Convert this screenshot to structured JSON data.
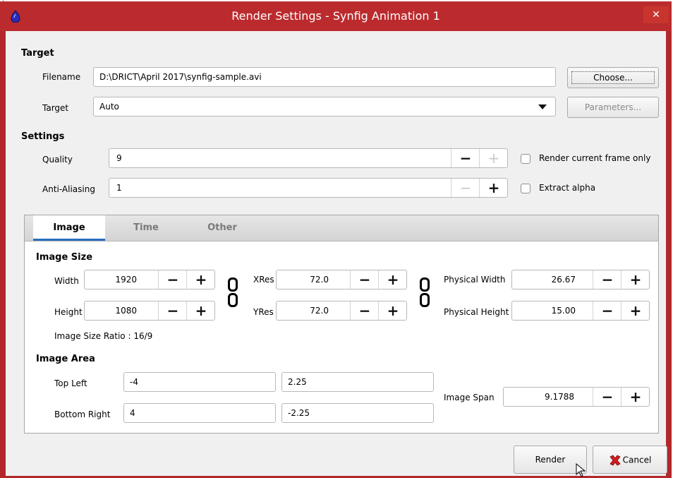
{
  "window": {
    "title": "Render Settings - Synfig Animation 1",
    "close_glyph": "✕"
  },
  "target": {
    "section": "Target",
    "filename_label": "Filename",
    "filename_value": "D:\\DRICT\\April 2017\\synfig-sample.avi",
    "choose_label": "Choose...",
    "target_label": "Target",
    "target_value": "Auto",
    "parameters_label": "Parameters..."
  },
  "settings": {
    "section": "Settings",
    "quality_label": "Quality",
    "quality_value": "9",
    "antialiasing_label": "Anti-Aliasing",
    "antialiasing_value": "1",
    "render_current_frame_label": "Render current frame only",
    "extract_alpha_label": "Extract alpha",
    "minus": "−",
    "plus": "+"
  },
  "tabs": {
    "image": "Image",
    "time": "Time",
    "other": "Other"
  },
  "image_size": {
    "section": "Image Size",
    "width_label": "Width",
    "width_value": "1920",
    "height_label": "Height",
    "height_value": "1080",
    "xres_label": "XRes",
    "xres_value": "72.0",
    "yres_label": "YRes",
    "yres_value": "72.0",
    "phys_width_label": "Physical Width",
    "phys_width_value": "26.67",
    "phys_height_label": "Physical Height",
    "phys_height_value": "15.00",
    "ratio_text": "Image Size Ratio : 16/9"
  },
  "image_area": {
    "section": "Image Area",
    "top_left_label": "Top Left",
    "top_left_x": "-4",
    "top_left_y": "2.25",
    "bottom_right_label": "Bottom Right",
    "bottom_right_x": "4",
    "bottom_right_y": "-2.25",
    "image_span_label": "Image Span",
    "image_span_value": "9.1788"
  },
  "footer": {
    "render_label": "Render",
    "cancel_label": "Cancel"
  },
  "colors": {
    "titlebar": "#bb2b2e",
    "tab_accent": "#2a6ebd",
    "cancel_icon": "#d11f1f"
  },
  "icons": [
    "synfig-app-icon",
    "close-icon",
    "dropdown-arrow-icon",
    "chain-link-icon",
    "cancel-x-icon",
    "mouse-cursor-icon"
  ]
}
